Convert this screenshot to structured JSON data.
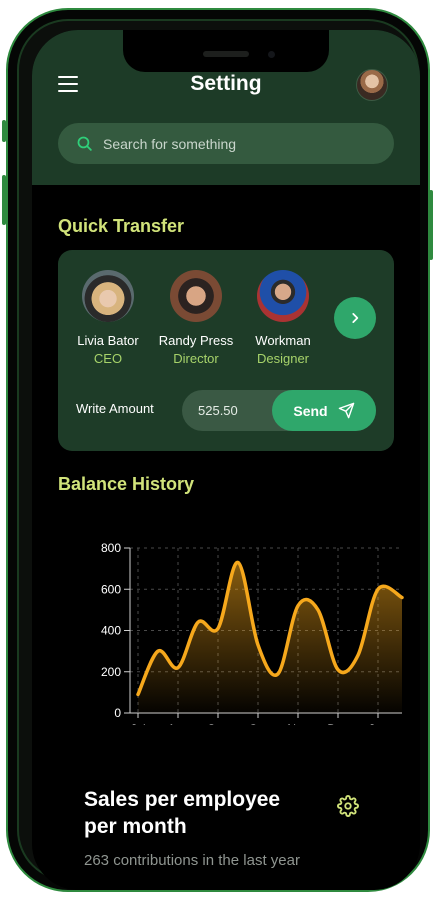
{
  "header": {
    "title": "Setting",
    "search_placeholder": "Search for something"
  },
  "quick_transfer": {
    "title": "Quick Transfer",
    "people": [
      {
        "name": "Livia Bator",
        "role": "CEO"
      },
      {
        "name": "Randy Press",
        "role": "Director"
      },
      {
        "name": "Workman",
        "role": "Designer"
      }
    ],
    "amount_label": "Write Amount",
    "amount_value": "525.50",
    "send_label": "Send"
  },
  "balance_history": {
    "title": "Balance History"
  },
  "chart_data": {
    "type": "area",
    "categories": [
      "Jul",
      "Aug",
      "Sep",
      "Oct",
      "Nov",
      "Dec",
      "Jan"
    ],
    "x": [
      0,
      0.5,
      1,
      1.5,
      2,
      2.5,
      3,
      3.5,
      4,
      4.5,
      5,
      5.5,
      6,
      6.6
    ],
    "values": [
      90,
      300,
      220,
      440,
      410,
      730,
      330,
      190,
      520,
      500,
      210,
      280,
      600,
      560
    ],
    "yticks": [
      0,
      200,
      400,
      600,
      800
    ],
    "ylim": [
      0,
      800
    ],
    "grid": true,
    "line_color": "#f6a81c"
  },
  "sales": {
    "title": "Sales per employee per month",
    "subtitle": "263 contributions in the last year"
  },
  "colors": {
    "accent_green": "#2fa76b",
    "header_green": "#1d3b27",
    "section_title": "#d1e37a",
    "role_text": "#a7d36a"
  }
}
